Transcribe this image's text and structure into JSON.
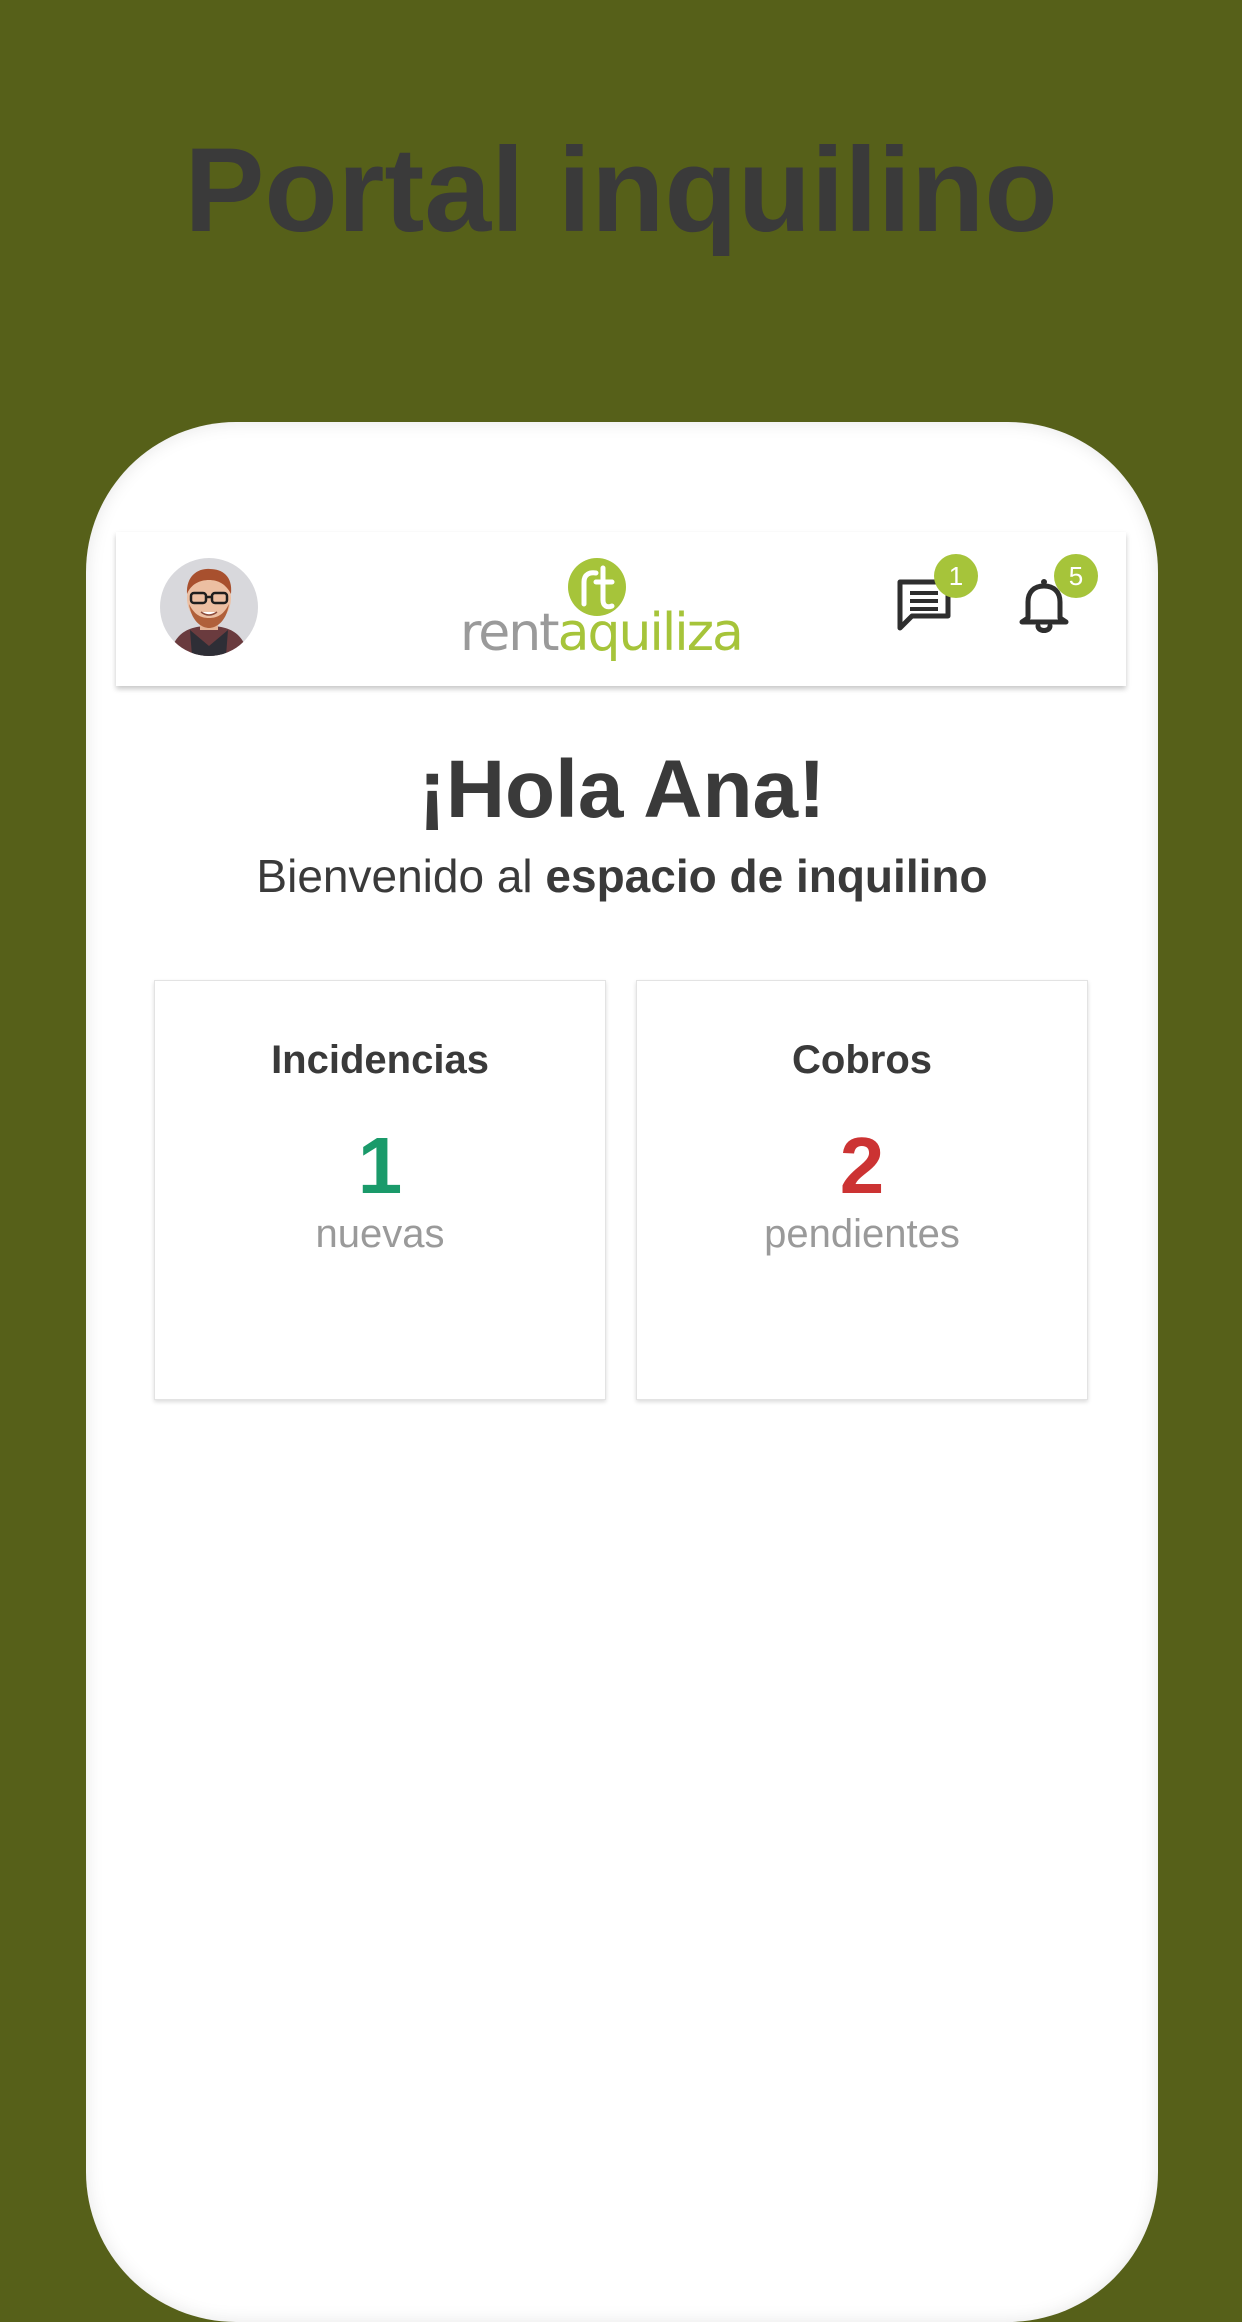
{
  "promo": {
    "title": "Portal inquilino"
  },
  "header": {
    "logo": {
      "mark_text": "rt",
      "part1": "rent",
      "part2": "aquiliza"
    },
    "messages_badge": "1",
    "notifications_badge": "5"
  },
  "main": {
    "greeting": "¡Hola Ana!",
    "welcome_prefix": "Bienvenido al ",
    "welcome_bold": "espacio de inquilino"
  },
  "cards": [
    {
      "title": "Incidencias",
      "count": "1",
      "caption": "nuevas",
      "count_color": "#1a9a6a"
    },
    {
      "title": "Cobros",
      "count": "2",
      "caption": "pendientes",
      "count_color": "#cc3333"
    }
  ],
  "colors": {
    "background": "#566019",
    "brand_green": "#a6c43a",
    "text_dark": "#3a3a3a",
    "text_muted": "#9a9a9a"
  },
  "icons": {
    "avatar": "user-avatar",
    "messages": "chat-icon",
    "notifications": "bell-icon"
  }
}
